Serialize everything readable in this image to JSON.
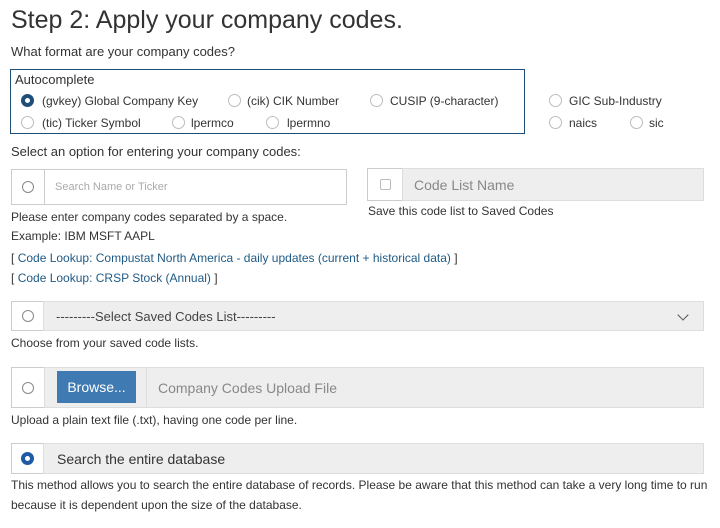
{
  "title": "Step 2: Apply your company codes.",
  "format_question": "What format are your company codes?",
  "format_group": {
    "legend": "Autocomplete",
    "options": [
      {
        "label": "(gvkey) Global Company Key",
        "selected": true
      },
      {
        "label": "(cik) CIK Number",
        "selected": false
      },
      {
        "label": "CUSIP (9-character)",
        "selected": false
      },
      {
        "label": "GIC Sub-Industry",
        "selected": false
      },
      {
        "label": "(tic) Ticker Symbol",
        "selected": false
      },
      {
        "label": "lpermco",
        "selected": false
      },
      {
        "label": "lpermno",
        "selected": false
      },
      {
        "label": "naics",
        "selected": false
      },
      {
        "label": "sic",
        "selected": false
      }
    ]
  },
  "entry_question": "Select an option for entering your company codes:",
  "manual_entry": {
    "search_placeholder": "Search Name or Ticker",
    "help_line1": "Please enter company codes separated by a space.",
    "help_line2": "Example: IBM MSFT AAPL",
    "code_list_name_placeholder": "Code List Name",
    "save_label": "Save this code list to Saved Codes",
    "links": [
      {
        "open": "[",
        "text": "Code Lookup: Compustat North America - daily updates (current + historical data)",
        "close": "]"
      },
      {
        "open": "[",
        "text": "Code Lookup: CRSP Stock (Annual)",
        "close": "]"
      }
    ]
  },
  "saved_codes": {
    "select_value": "---------Select Saved Codes List---------",
    "help": "Choose from your saved code lists."
  },
  "upload": {
    "browse_label": "Browse...",
    "file_placeholder": "Company Codes Upload File",
    "help": "Upload a plain text file (.txt), having one code per line."
  },
  "entire_db": {
    "label": "Search the entire database",
    "selected": true,
    "help_line1": "This method allows you to search the entire database of records. Please be aware that this method can take a very long time to run",
    "help_line2": "because it is dependent upon the size of the database."
  },
  "colors": {
    "accent": "#1f5aa6",
    "browse_button": "#3f7ab3",
    "link": "#1f5a85",
    "fieldset_border": "#1f4e79"
  }
}
